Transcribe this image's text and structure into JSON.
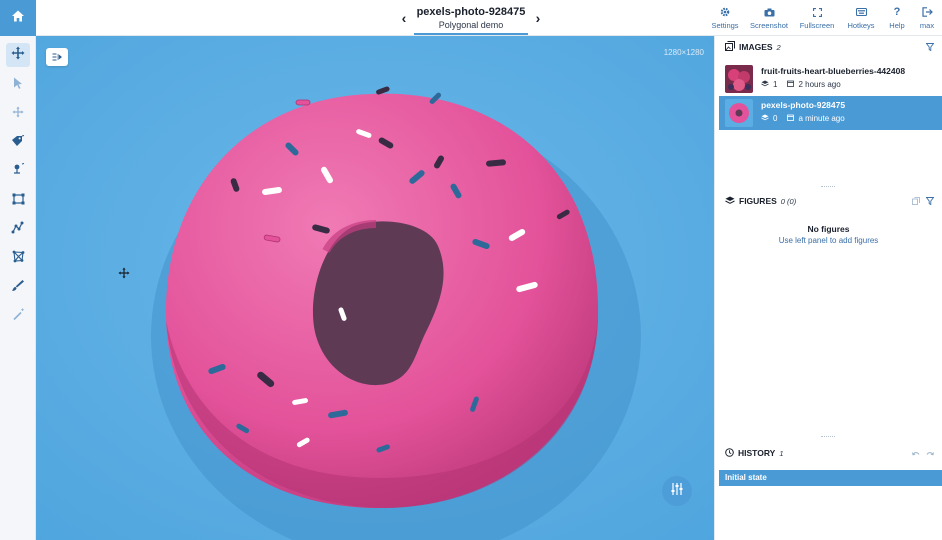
{
  "topbar": {
    "home_icon": "home-icon",
    "image_title": "pexels-photo-928475",
    "image_subtitle": "Polygonal demo",
    "prev_glyph": "‹",
    "next_glyph": "›",
    "tools": [
      {
        "label": "Settings",
        "icon": "gear-icon"
      },
      {
        "label": "Screenshot",
        "icon": "camera-icon"
      },
      {
        "label": "Fullscreen",
        "icon": "fullscreen-icon"
      },
      {
        "label": "Hotkeys",
        "icon": "keyboard-icon"
      },
      {
        "label": "Help",
        "icon": "question-icon"
      },
      {
        "label": "max",
        "icon": "logout-icon"
      }
    ]
  },
  "left_tools": [
    {
      "name": "move-tool",
      "icon": "move-icon",
      "active": true
    },
    {
      "name": "select-tool",
      "icon": "pointer-icon",
      "active": false
    },
    {
      "name": "drag-tool",
      "icon": "drag-icon",
      "active": false
    },
    {
      "name": "tag-tool",
      "icon": "tag-icon",
      "active": false
    },
    {
      "name": "point-tool",
      "icon": "point-icon",
      "active": false
    },
    {
      "name": "rectangle-tool",
      "icon": "rectangle-icon",
      "active": false
    },
    {
      "name": "polyline-tool",
      "icon": "polyline-icon",
      "active": false
    },
    {
      "name": "polygon-tool",
      "icon": "polygon-icon",
      "active": false
    },
    {
      "name": "brush-tool",
      "icon": "brush-icon",
      "active": false
    },
    {
      "name": "magic-wand-tool",
      "icon": "magic-wand-icon",
      "active": false
    }
  ],
  "canvas": {
    "dimensions": "1280×1280"
  },
  "images_panel": {
    "title": "IMAGES",
    "count": "2",
    "items": [
      {
        "name": "fruit-fruits-heart-blueberries-442408",
        "figures": "1",
        "time": "2 hours ago",
        "active": false
      },
      {
        "name": "pexels-photo-928475",
        "figures": "0",
        "time": "a minute ago",
        "active": true
      }
    ]
  },
  "figures_panel": {
    "title": "FIGURES",
    "count": "0 (0)",
    "empty_title": "No figures",
    "empty_hint": "Use left panel to add figures"
  },
  "history_panel": {
    "title": "HISTORY",
    "count": "1",
    "items": [
      "Initial state"
    ]
  },
  "colors": {
    "accent": "#4a9ad6",
    "canvas_bg": "#5aaee3",
    "donut": "#e6559a"
  }
}
